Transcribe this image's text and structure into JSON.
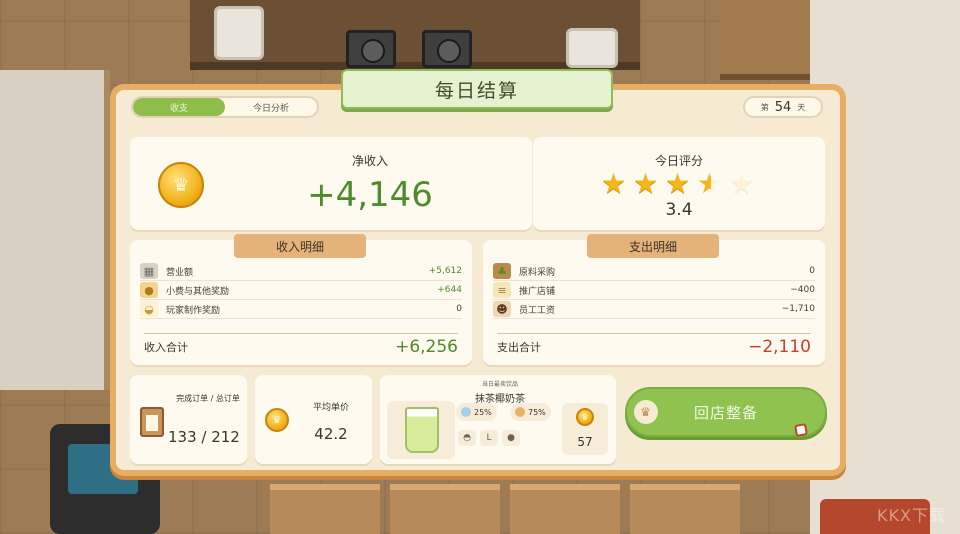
{
  "header": {
    "title": "每日结算",
    "tabs": [
      {
        "label": "收支",
        "active": true
      },
      {
        "label": "今日分析",
        "active": false
      }
    ],
    "day": {
      "prefix": "第",
      "number": "54",
      "suffix": "天"
    }
  },
  "summary": {
    "net_income_label": "净收入",
    "net_income_value": "+4,146",
    "rating_label": "今日评分",
    "rating_value": "3.4",
    "stars": {
      "filled": 3,
      "half": 1,
      "empty": 1,
      "max": 5
    }
  },
  "income": {
    "heading": "收入明细",
    "rows": [
      {
        "icon": "cash-register-icon",
        "label": "营业额",
        "value": "+5,612"
      },
      {
        "icon": "tip-jar-icon",
        "label": "小费与其他奖励",
        "value": "+644"
      },
      {
        "icon": "chef-dish-icon",
        "label": "玩家制作奖励",
        "value": "0"
      }
    ],
    "total_label": "收入合计",
    "total_value": "+6,256"
  },
  "expense": {
    "heading": "支出明细",
    "rows": [
      {
        "icon": "ingredients-basket-icon",
        "label": "原料采购",
        "value": "0"
      },
      {
        "icon": "flyer-icon",
        "label": "推广店铺",
        "value": "−400"
      },
      {
        "icon": "staff-icon",
        "label": "员工工资",
        "value": "−1,710"
      }
    ],
    "total_label": "支出合计",
    "total_value": "−2,110"
  },
  "orders": {
    "label": "完成订单 / 总订单",
    "value": "133 / 212"
  },
  "average": {
    "label": "平均单价",
    "value": "42.2"
  },
  "best_drink": {
    "subtitle": "当日最卖饮品",
    "name": "抹茶椰奶茶",
    "attributes": [
      {
        "icon": "ice-icon",
        "value": "25%"
      },
      {
        "icon": "sugar-icon",
        "value": "75%"
      }
    ],
    "toppings": [
      "whipped-cream-icon",
      "cup-size-icon",
      "tapioca-icon"
    ],
    "price": "57"
  },
  "actions": {
    "return_label": "回店整备"
  },
  "watermark": "KKX下载",
  "colors": {
    "accent_green": "#8fc24f",
    "income_green": "#4f8a2b",
    "expense_red": "#c4432b",
    "panel_bg": "#f7ead2",
    "panel_border": "#e7ad64",
    "star_gold": "#f5b51c"
  }
}
